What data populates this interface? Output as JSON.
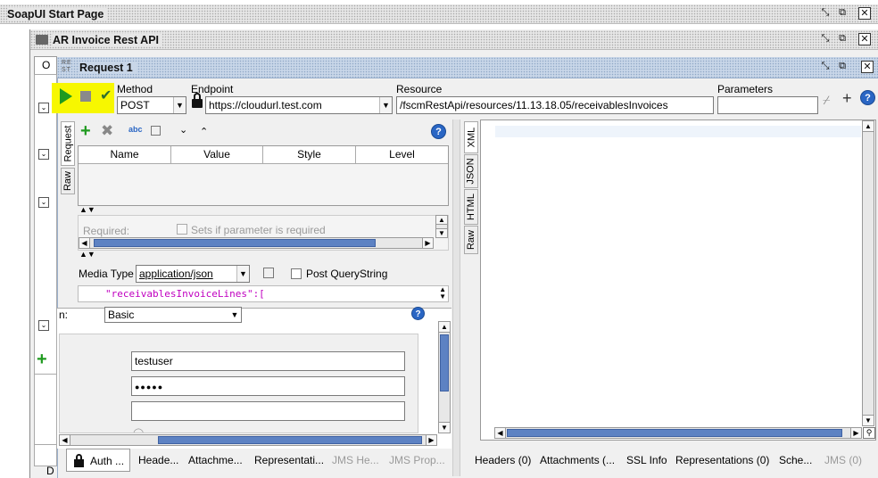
{
  "windows": {
    "start_page": {
      "title": "SoapUI Start Page"
    },
    "project": {
      "title": "AR Invoice Rest API"
    },
    "request": {
      "title": "Request 1",
      "badge": "RE ST"
    }
  },
  "toolbar": {
    "method_label": "Method",
    "method_value": "POST",
    "endpoint_label": "Endpoint",
    "endpoint_value": "https://cloudurl.test.com",
    "resource_label": "Resource",
    "resource_value": "/fscmRestApi/resources/11.13.18.05/receivablesInvoices",
    "parameters_label": "Parameters",
    "parameters_value": ""
  },
  "request_panel": {
    "tabs": [
      "Request",
      "Raw"
    ],
    "table_headers": [
      "Name",
      "Value",
      "Style",
      "Level"
    ],
    "required_label": "Required:",
    "required_checkbox_label": "Sets if parameter is required",
    "media_type_label": "Media Type",
    "media_type_value": "application/json",
    "post_querystring_label": "Post QueryString",
    "body_line": "\"receivablesInvoiceLines\":["
  },
  "auth_panel": {
    "type_label": "n:",
    "type_value": "Basic",
    "username": "testuser",
    "password_masked": "●●●●●",
    "domain": "",
    "cut_text": "◯ ..."
  },
  "request_bottom_tabs": [
    "Auth ...",
    "Heade...",
    "Attachme...",
    "Representati...",
    "JMS He...",
    "JMS Prop..."
  ],
  "response_panel": {
    "tabs": [
      "XML",
      "JSON",
      "HTML",
      "Raw"
    ]
  },
  "response_bottom_tabs": [
    "Headers (0)",
    "Attachments (...",
    "SSL Info",
    "Representations (0)",
    "Sche...",
    "JMS (0)"
  ],
  "left_edge": {
    "tab_o": "O",
    "tab_d": "D"
  },
  "colors": {
    "highlight": "#f7f700",
    "run_green": "#1f9a1f",
    "scroll_thumb": "#5d82c3",
    "json_key": "#c000c0"
  }
}
